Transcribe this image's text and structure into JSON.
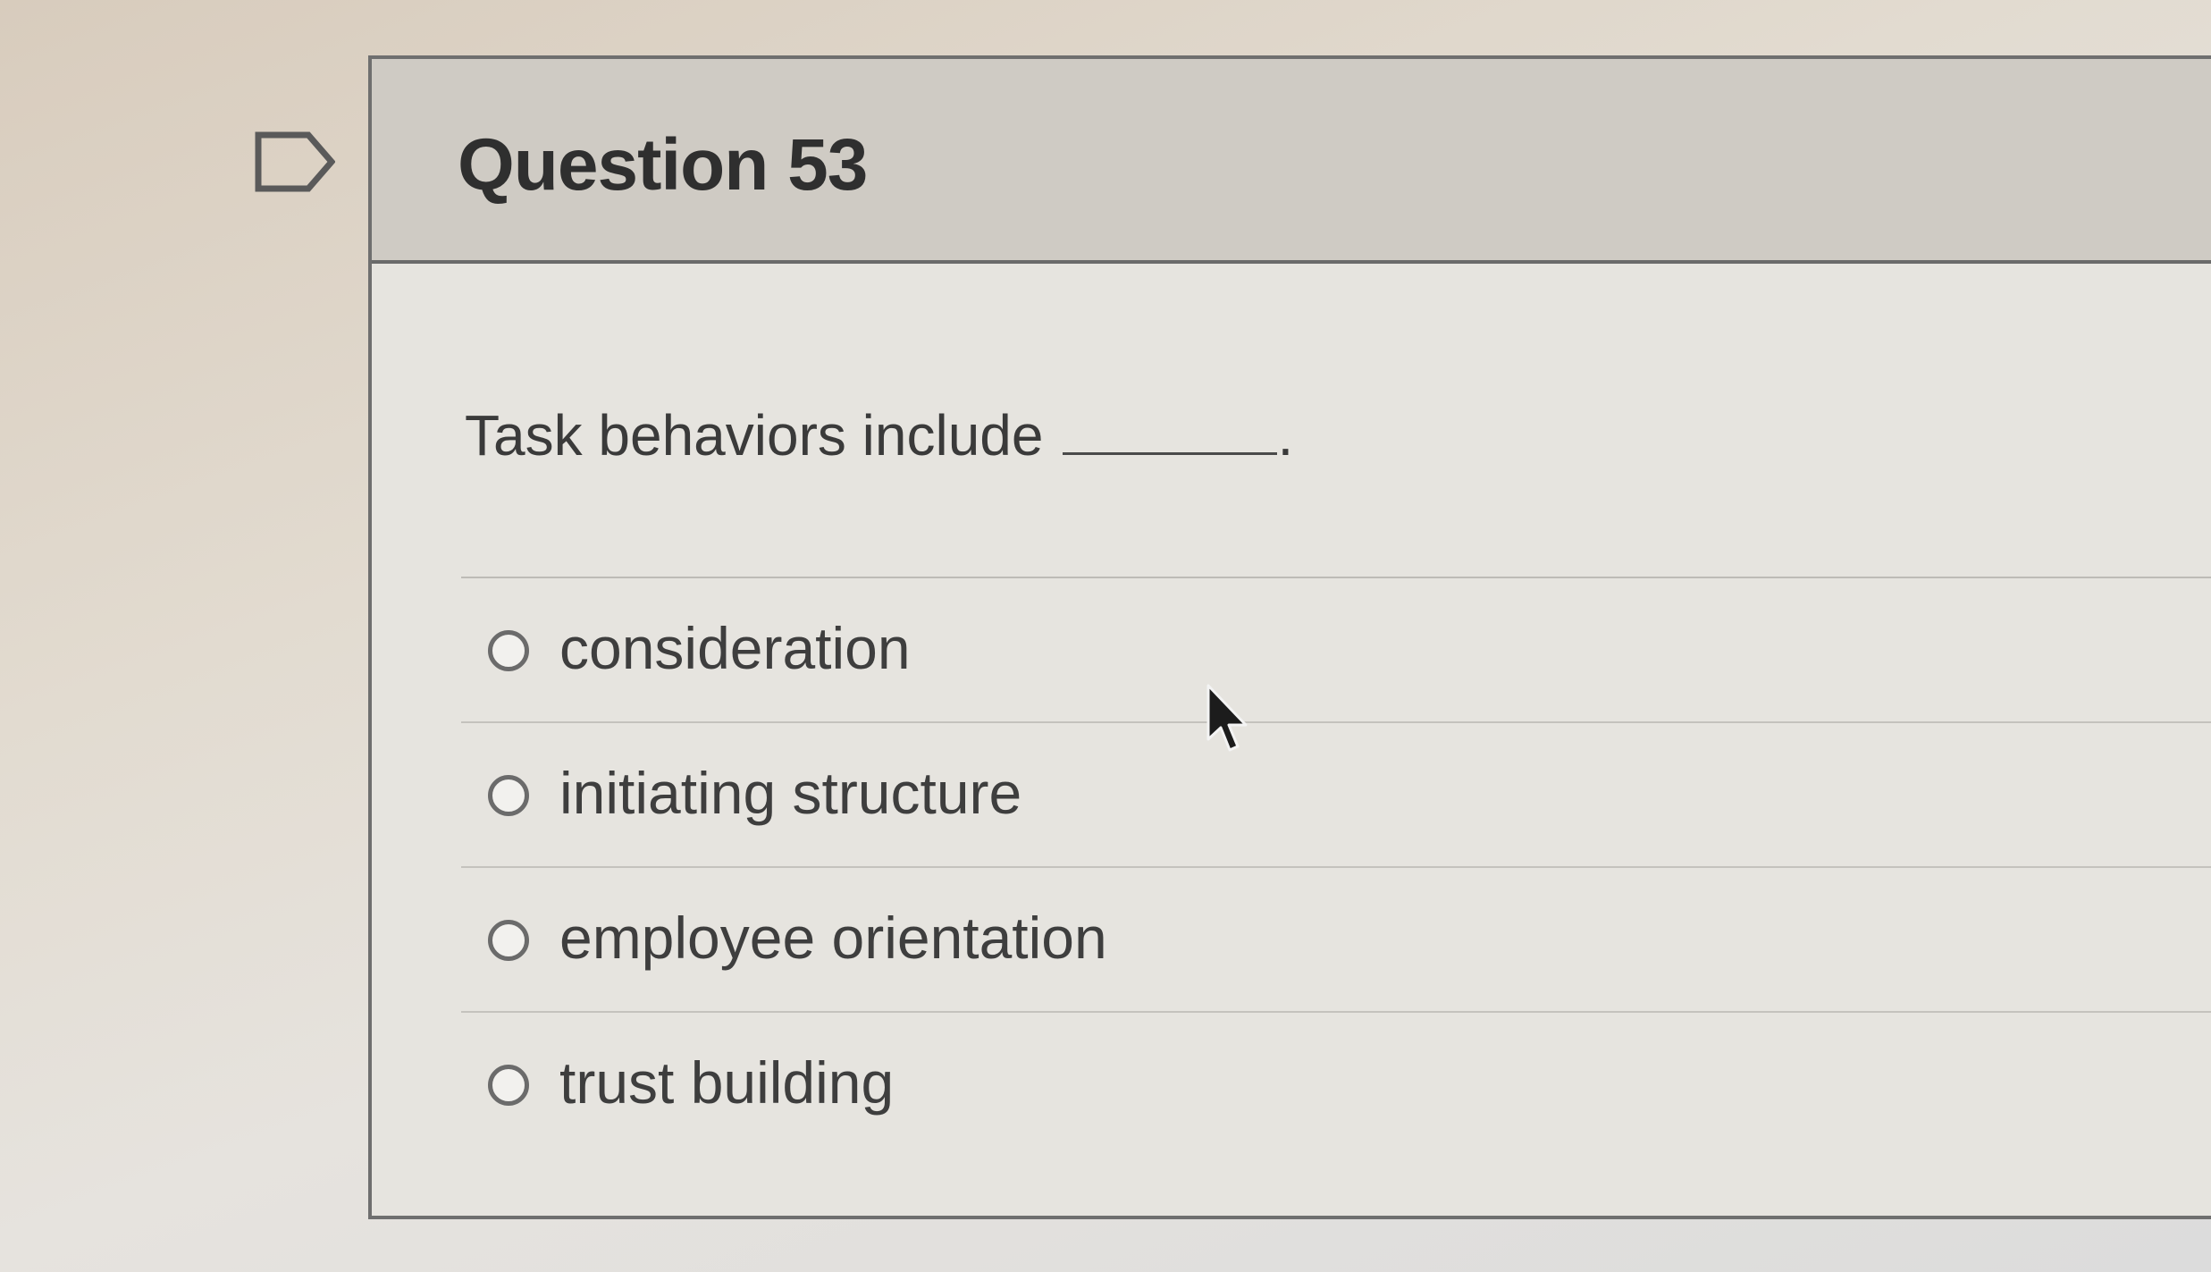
{
  "question": {
    "title": "Question 53",
    "prompt": "Task behaviors include",
    "prompt_suffix": "."
  },
  "answers": [
    {
      "label": "consideration",
      "selected": false
    },
    {
      "label": "initiating structure",
      "selected": false
    },
    {
      "label": "employee orientation",
      "selected": false
    },
    {
      "label": "trust building",
      "selected": false
    }
  ],
  "icons": {
    "flag": "flag-question-icon",
    "cursor": "mouse-pointer-icon",
    "radio": "radio-unchecked-icon"
  }
}
